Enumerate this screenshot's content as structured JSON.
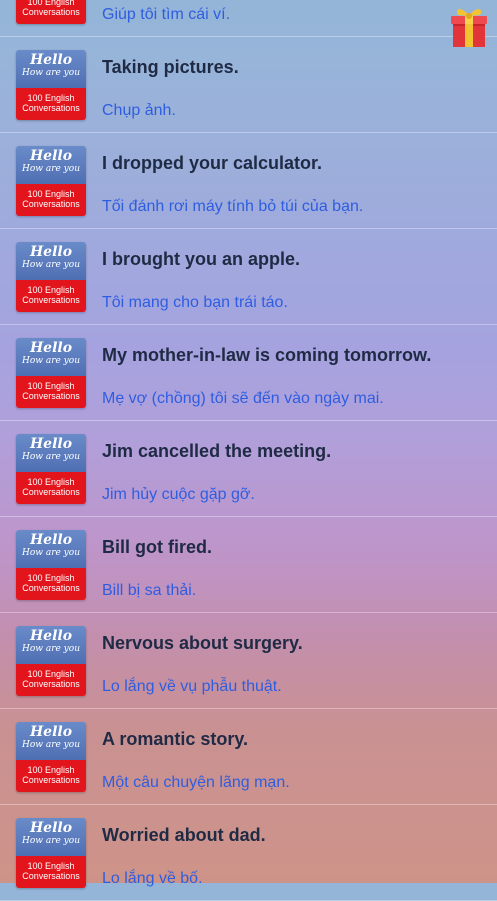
{
  "thumbnail": {
    "hello": "Hello",
    "how": "How are you",
    "line1": "100 English",
    "line2": "Conversations"
  },
  "items": [
    {
      "title": "",
      "subtitle": "Giúp tôi tìm cái ví."
    },
    {
      "title": "Taking pictures.",
      "subtitle": "Chụp ảnh."
    },
    {
      "title": "I dropped your calculator.",
      "subtitle": "Tối đánh rơi máy tính bỏ túi của bạn."
    },
    {
      "title": "I brought you an apple.",
      "subtitle": "Tôi mang cho bạn trái táo."
    },
    {
      "title": "My mother-in-law is coming tomorrow.",
      "subtitle": "Mẹ vợ (chồng) tôi sẽ đến vào ngày mai."
    },
    {
      "title": "Jim cancelled the meeting.",
      "subtitle": "Jim hủy cuộc gặp gỡ."
    },
    {
      "title": "Bill got fired.",
      "subtitle": "Bill bị sa thải."
    },
    {
      "title": "Nervous about surgery.",
      "subtitle": "Lo lắng về vụ phẫu thuật."
    },
    {
      "title": "A romantic story.",
      "subtitle": "Một câu chuyện lãng mạn."
    },
    {
      "title": "Worried about dad.",
      "subtitle": "Lo lắng về bố."
    }
  ],
  "colors": {
    "title": "#1f2a44",
    "subtitle": "#2f5de0",
    "thumb_blue": "#5877bb",
    "thumb_red": "#e2141c"
  },
  "icons": {
    "gift": "gift-icon"
  }
}
